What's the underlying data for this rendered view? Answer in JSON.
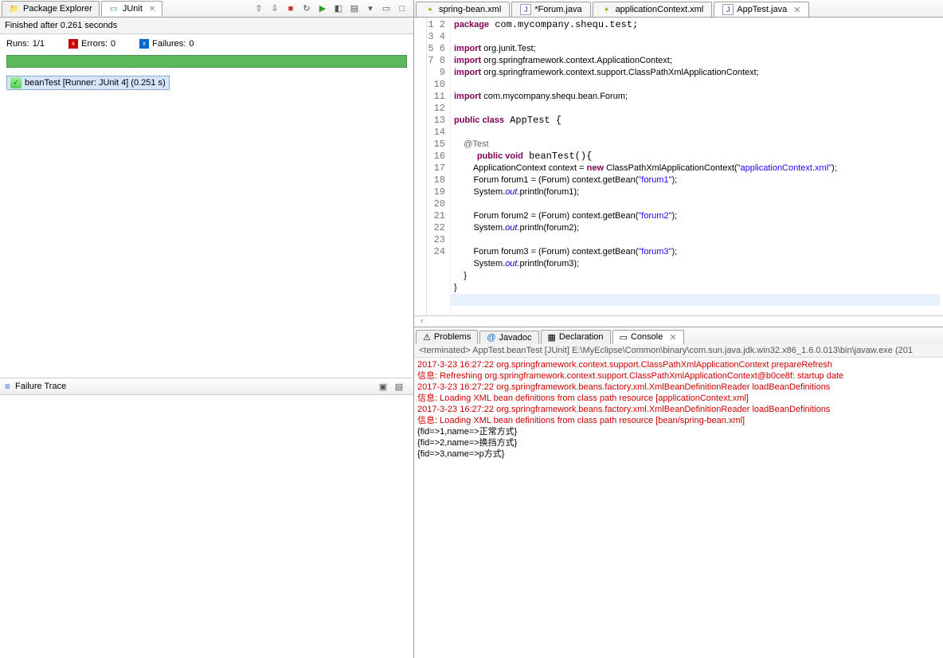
{
  "left": {
    "tabs": [
      {
        "label": "Package Explorer"
      },
      {
        "label": "JUnit"
      }
    ],
    "junit": {
      "finished": "Finished after 0.261 seconds",
      "runs_label": "Runs:",
      "runs_value": "1/1",
      "errors_label": "Errors:",
      "errors_value": "0",
      "failures_label": "Failures:",
      "failures_value": "0",
      "test_tree": [
        {
          "label": "beanTest [Runner: JUnit 4] (0.251 s)"
        }
      ],
      "failure_trace_title": "Failure Trace"
    }
  },
  "editor": {
    "tabs": [
      {
        "label": "spring-bean.xml",
        "type": "xml"
      },
      {
        "label": "*Forum.java",
        "type": "java"
      },
      {
        "label": "applicationContext.xml",
        "type": "xml"
      },
      {
        "label": "AppTest.java",
        "type": "java",
        "active": true
      }
    ],
    "code": {
      "lines": 24,
      "l1": "package com.mycompany.shequ.test;",
      "l3a": "import",
      "l3b": " org.junit.Test;",
      "l4a": "import",
      "l4b": " org.springframework.context.ApplicationContext;",
      "l5a": "import",
      "l5b": " org.springframework.context.support.ClassPathXmlApplicationContext;",
      "l7a": "import",
      "l7b": " com.mycompany.shequ.bean.Forum;",
      "l9": "public class AppTest {",
      "l11": "    @Test",
      "l12": "    public void beanTest(){",
      "l13a": "        ApplicationContext context = ",
      "l13b": "new",
      "l13c": " ClassPathXmlApplicationContext(",
      "l13s": "\"applicationContext.xml\"",
      "l13d": ");",
      "l14a": "        Forum forum1 = (Forum) context.getBean(",
      "l14s": "\"forum1\"",
      "l14b": ");",
      "l15a": "        System.",
      "l15o": "out",
      "l15b": ".println(forum1);",
      "l17a": "        Forum forum2 = (Forum) context.getBean(",
      "l17s": "\"forum2\"",
      "l17b": ");",
      "l18a": "        System.",
      "l18o": "out",
      "l18b": ".println(forum2);",
      "l20a": "        Forum forum3 = (Forum) context.getBean(",
      "l20s": "\"forum3\"",
      "l20b": ");",
      "l21a": "        System.",
      "l21o": "out",
      "l21b": ".println(forum3);",
      "l22": "    }",
      "l23": "}"
    }
  },
  "bottom": {
    "tabs": [
      {
        "label": "Problems"
      },
      {
        "label": "Javadoc"
      },
      {
        "label": "Declaration"
      },
      {
        "label": "Console",
        "active": true
      }
    ],
    "console_header": "<terminated> AppTest.beanTest [JUnit] E:\\MyEclipse\\Common\\binary\\com.sun.java.jdk.win32.x86_1.6.0.013\\bin\\javaw.exe (201",
    "console_lines": [
      {
        "c": "red",
        "t": "2017-3-23 16:27:22 org.springframework.context.support.ClassPathXmlApplicationContext prepareRefresh"
      },
      {
        "c": "red",
        "t": "信息: Refreshing org.springframework.context.support.ClassPathXmlApplicationContext@b0ce8f: startup date"
      },
      {
        "c": "red",
        "t": "2017-3-23 16:27:22 org.springframework.beans.factory.xml.XmlBeanDefinitionReader loadBeanDefinitions"
      },
      {
        "c": "red",
        "t": "信息: Loading XML bean definitions from class path resource [applicationContext.xml]"
      },
      {
        "c": "red",
        "t": "2017-3-23 16:27:22 org.springframework.beans.factory.xml.XmlBeanDefinitionReader loadBeanDefinitions"
      },
      {
        "c": "red",
        "t": "信息: Loading XML bean definitions from class path resource [bean/spring-bean.xml]"
      },
      {
        "c": "",
        "t": "{fid=>1,name=>正常方式}"
      },
      {
        "c": "",
        "t": "{fid=>2,name=>换挡方式}"
      },
      {
        "c": "",
        "t": "{fid=>3,name=>p方式}"
      }
    ]
  }
}
